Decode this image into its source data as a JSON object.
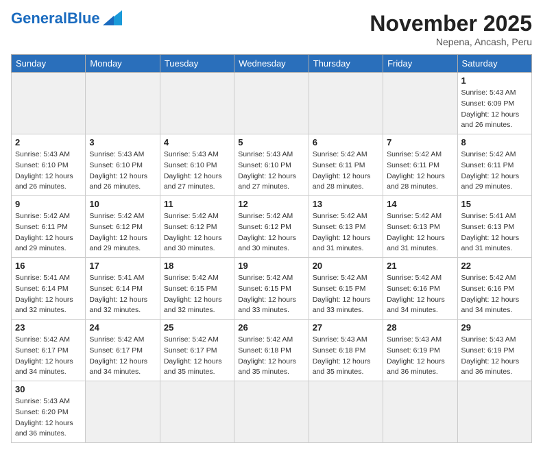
{
  "header": {
    "logo_general": "General",
    "logo_blue": "Blue",
    "month_title": "November 2025",
    "location": "Nepena, Ancash, Peru"
  },
  "days_of_week": [
    "Sunday",
    "Monday",
    "Tuesday",
    "Wednesday",
    "Thursday",
    "Friday",
    "Saturday"
  ],
  "weeks": [
    {
      "days": [
        {
          "num": "",
          "info": ""
        },
        {
          "num": "",
          "info": ""
        },
        {
          "num": "",
          "info": ""
        },
        {
          "num": "",
          "info": ""
        },
        {
          "num": "",
          "info": ""
        },
        {
          "num": "",
          "info": ""
        },
        {
          "num": "1",
          "info": "Sunrise: 5:43 AM\nSunset: 6:09 PM\nDaylight: 12 hours and 26 minutes."
        }
      ]
    },
    {
      "days": [
        {
          "num": "2",
          "info": "Sunrise: 5:43 AM\nSunset: 6:10 PM\nDaylight: 12 hours and 26 minutes."
        },
        {
          "num": "3",
          "info": "Sunrise: 5:43 AM\nSunset: 6:10 PM\nDaylight: 12 hours and 26 minutes."
        },
        {
          "num": "4",
          "info": "Sunrise: 5:43 AM\nSunset: 6:10 PM\nDaylight: 12 hours and 27 minutes."
        },
        {
          "num": "5",
          "info": "Sunrise: 5:43 AM\nSunset: 6:10 PM\nDaylight: 12 hours and 27 minutes."
        },
        {
          "num": "6",
          "info": "Sunrise: 5:42 AM\nSunset: 6:11 PM\nDaylight: 12 hours and 28 minutes."
        },
        {
          "num": "7",
          "info": "Sunrise: 5:42 AM\nSunset: 6:11 PM\nDaylight: 12 hours and 28 minutes."
        },
        {
          "num": "8",
          "info": "Sunrise: 5:42 AM\nSunset: 6:11 PM\nDaylight: 12 hours and 29 minutes."
        }
      ]
    },
    {
      "days": [
        {
          "num": "9",
          "info": "Sunrise: 5:42 AM\nSunset: 6:11 PM\nDaylight: 12 hours and 29 minutes."
        },
        {
          "num": "10",
          "info": "Sunrise: 5:42 AM\nSunset: 6:12 PM\nDaylight: 12 hours and 29 minutes."
        },
        {
          "num": "11",
          "info": "Sunrise: 5:42 AM\nSunset: 6:12 PM\nDaylight: 12 hours and 30 minutes."
        },
        {
          "num": "12",
          "info": "Sunrise: 5:42 AM\nSunset: 6:12 PM\nDaylight: 12 hours and 30 minutes."
        },
        {
          "num": "13",
          "info": "Sunrise: 5:42 AM\nSunset: 6:13 PM\nDaylight: 12 hours and 31 minutes."
        },
        {
          "num": "14",
          "info": "Sunrise: 5:42 AM\nSunset: 6:13 PM\nDaylight: 12 hours and 31 minutes."
        },
        {
          "num": "15",
          "info": "Sunrise: 5:41 AM\nSunset: 6:13 PM\nDaylight: 12 hours and 31 minutes."
        }
      ]
    },
    {
      "days": [
        {
          "num": "16",
          "info": "Sunrise: 5:41 AM\nSunset: 6:14 PM\nDaylight: 12 hours and 32 minutes."
        },
        {
          "num": "17",
          "info": "Sunrise: 5:41 AM\nSunset: 6:14 PM\nDaylight: 12 hours and 32 minutes."
        },
        {
          "num": "18",
          "info": "Sunrise: 5:42 AM\nSunset: 6:15 PM\nDaylight: 12 hours and 32 minutes."
        },
        {
          "num": "19",
          "info": "Sunrise: 5:42 AM\nSunset: 6:15 PM\nDaylight: 12 hours and 33 minutes."
        },
        {
          "num": "20",
          "info": "Sunrise: 5:42 AM\nSunset: 6:15 PM\nDaylight: 12 hours and 33 minutes."
        },
        {
          "num": "21",
          "info": "Sunrise: 5:42 AM\nSunset: 6:16 PM\nDaylight: 12 hours and 34 minutes."
        },
        {
          "num": "22",
          "info": "Sunrise: 5:42 AM\nSunset: 6:16 PM\nDaylight: 12 hours and 34 minutes."
        }
      ]
    },
    {
      "days": [
        {
          "num": "23",
          "info": "Sunrise: 5:42 AM\nSunset: 6:17 PM\nDaylight: 12 hours and 34 minutes."
        },
        {
          "num": "24",
          "info": "Sunrise: 5:42 AM\nSunset: 6:17 PM\nDaylight: 12 hours and 34 minutes."
        },
        {
          "num": "25",
          "info": "Sunrise: 5:42 AM\nSunset: 6:17 PM\nDaylight: 12 hours and 35 minutes."
        },
        {
          "num": "26",
          "info": "Sunrise: 5:42 AM\nSunset: 6:18 PM\nDaylight: 12 hours and 35 minutes."
        },
        {
          "num": "27",
          "info": "Sunrise: 5:43 AM\nSunset: 6:18 PM\nDaylight: 12 hours and 35 minutes."
        },
        {
          "num": "28",
          "info": "Sunrise: 5:43 AM\nSunset: 6:19 PM\nDaylight: 12 hours and 36 minutes."
        },
        {
          "num": "29",
          "info": "Sunrise: 5:43 AM\nSunset: 6:19 PM\nDaylight: 12 hours and 36 minutes."
        }
      ]
    },
    {
      "days": [
        {
          "num": "30",
          "info": "Sunrise: 5:43 AM\nSunset: 6:20 PM\nDaylight: 12 hours and 36 minutes."
        },
        {
          "num": "",
          "info": ""
        },
        {
          "num": "",
          "info": ""
        },
        {
          "num": "",
          "info": ""
        },
        {
          "num": "",
          "info": ""
        },
        {
          "num": "",
          "info": ""
        },
        {
          "num": "",
          "info": ""
        }
      ]
    }
  ]
}
